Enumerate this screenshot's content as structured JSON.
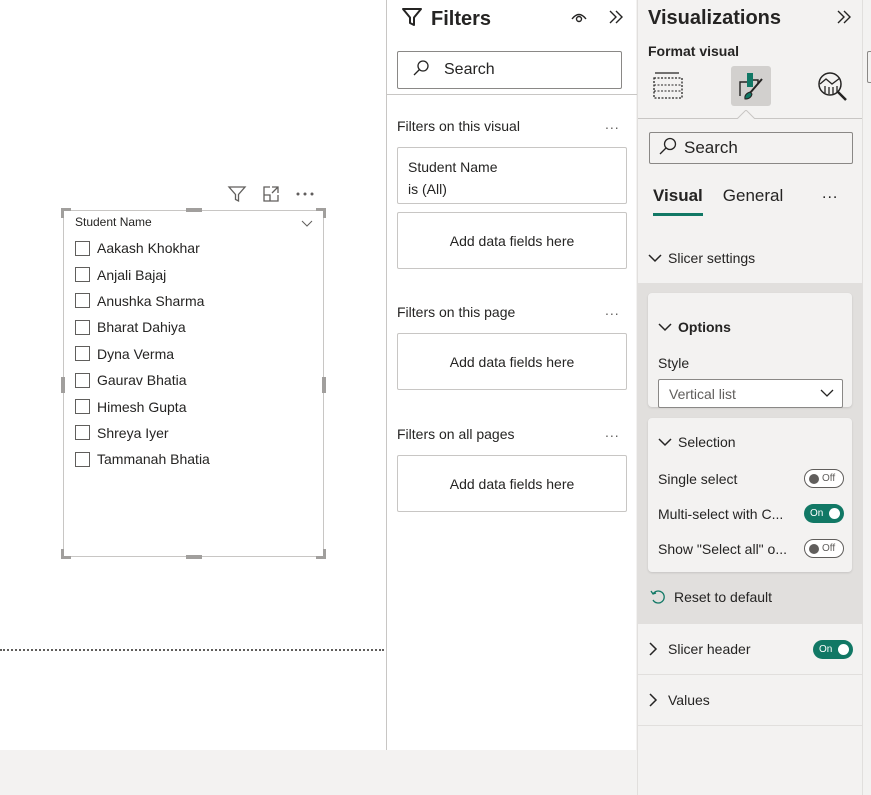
{
  "canvas": {
    "slicer": {
      "header_icons": [
        "filter-icon",
        "focus-mode-icon",
        "more-options-icon"
      ],
      "title": "Student Name",
      "items": [
        {
          "label": "Aakash Khokhar",
          "checked": false
        },
        {
          "label": "Anjali Bajaj",
          "checked": false
        },
        {
          "label": "Anushka Sharma",
          "checked": false
        },
        {
          "label": "Bharat Dahiya",
          "checked": false
        },
        {
          "label": "Dyna Verma",
          "checked": false
        },
        {
          "label": "Gaurav Bhatia",
          "checked": false
        },
        {
          "label": "Himesh Gupta",
          "checked": false
        },
        {
          "label": "Shreya Iyer",
          "checked": false
        },
        {
          "label": "Tammanah Bhatia",
          "checked": false
        }
      ]
    }
  },
  "filters": {
    "title": "Filters",
    "search_placeholder": "Search",
    "sections": [
      {
        "label": "Filters on this visual",
        "more": "..."
      },
      {
        "label": "Filters on this page",
        "more": "..."
      },
      {
        "label": "Filters on all pages",
        "more": "..."
      }
    ],
    "visual_filter": {
      "field": "Student Name",
      "condition": "is (All)"
    },
    "drop_label": "Add data fields here"
  },
  "visualizations": {
    "title": "Visualizations",
    "subtitle": "Format visual",
    "pane_icons": [
      "build-visual-icon",
      "format-visual-icon",
      "analytics-icon"
    ],
    "search_placeholder": "Search",
    "tabs": [
      {
        "label": "Visual",
        "active": true
      },
      {
        "label": "General",
        "active": false
      }
    ],
    "tabs_more": "...",
    "slicer_settings": {
      "label": "Slicer settings",
      "options": {
        "label": "Options",
        "style_label": "Style",
        "style_value": "Vertical list"
      },
      "selection": {
        "label": "Selection",
        "rows": [
          {
            "label": "Single select",
            "state": "Off"
          },
          {
            "label": "Multi-select with C...",
            "state": "On"
          },
          {
            "label": "Show \"Select all\" o...",
            "state": "Off"
          }
        ]
      },
      "reset_label": "Reset to default"
    },
    "sections": [
      {
        "label": "Slicer header",
        "toggle": "On"
      },
      {
        "label": "Values"
      }
    ]
  },
  "colors": {
    "accent": "#117865",
    "panel_bg": "#f3f2f1",
    "border": "#c8c6c4"
  }
}
